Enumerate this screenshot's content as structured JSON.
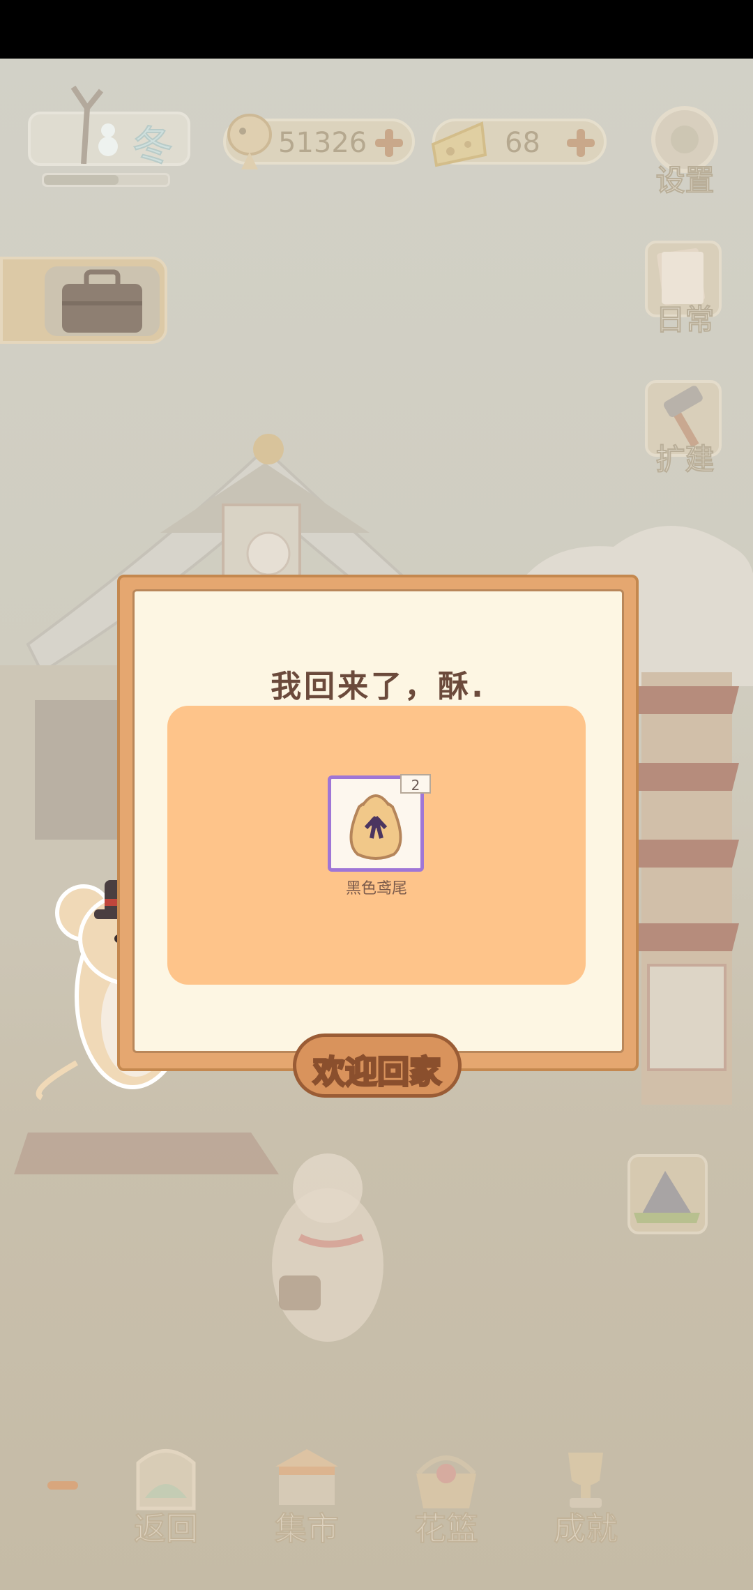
{
  "hud": {
    "season_label": "冬",
    "season_progress": 0.6,
    "fish_bones": "51326",
    "cheese": "68"
  },
  "side_buttons": {
    "settings": "设置",
    "daily": "日常",
    "expand": "扩建"
  },
  "modal": {
    "title": "我回来了，酥.",
    "reward_item": {
      "name": "黑色鸢尾",
      "count": "2",
      "icon": "seed-bag-icon"
    },
    "confirm_label": "欢迎回家",
    "rarity_color": "#9f76d6"
  },
  "bottom_nav": {
    "items": [
      {
        "label": "返回",
        "icon": "return-window-icon"
      },
      {
        "label": "集市",
        "icon": "market-stall-icon"
      },
      {
        "label": "花篮",
        "icon": "flower-basket-icon"
      },
      {
        "label": "成就",
        "icon": "trophy-icon"
      }
    ]
  },
  "colors": {
    "accent": "#e5a770",
    "panel": "#fec48a",
    "button": "#d9935c"
  }
}
